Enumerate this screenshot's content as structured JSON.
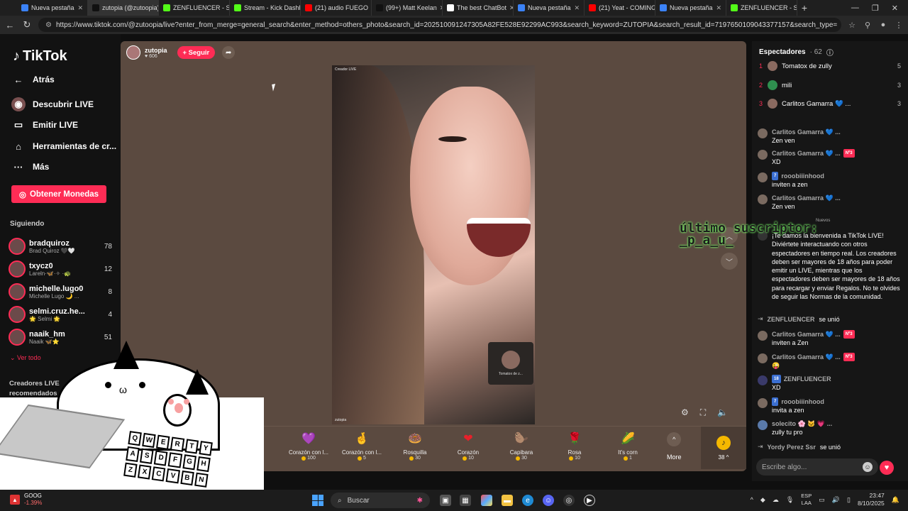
{
  "tabs": [
    {
      "label": "Nueva pestaña",
      "color": "#3b82f6"
    },
    {
      "label": "zutopia (@zutoopia)",
      "color": "#111111"
    },
    {
      "label": "ZENFLUENCER - Stream",
      "color": "#53fc18"
    },
    {
      "label": "Stream - Kick Dashboard",
      "color": "#53fc18"
    },
    {
      "label": "(21) audio FUEGO",
      "color": "#ff0000"
    },
    {
      "label": "(99+) Matt Keelan",
      "color": "#111111"
    },
    {
      "label": "The best ChatBot",
      "color": "#ffffff"
    },
    {
      "label": "Nueva pestaña",
      "color": "#3b82f6"
    },
    {
      "label": "(21) Yeat - COMING",
      "color": "#ff0000"
    },
    {
      "label": "Nueva pestaña",
      "color": "#3b82f6"
    },
    {
      "label": "ZENFLUENCER - Stream",
      "color": "#53fc18"
    }
  ],
  "browser": {
    "url": "https://www.tiktok.com/@zutoopia/live?enter_from_merge=general_search&enter_method=others_photo&search_id=202510091247305A82FE528E92299AC993&search_keyword=ZUTOPIA&search_result_id=7197650109043377157&search_type="
  },
  "sidebar": {
    "logo": "TikTok",
    "back": "Atrás",
    "nav": [
      {
        "label": "Descubrir LIVE",
        "icon": "live-discover-icon"
      },
      {
        "label": "Emitir LIVE",
        "icon": "camera-icon"
      },
      {
        "label": "Herramientas de cr...",
        "icon": "home-tools-icon"
      },
      {
        "label": "Más",
        "icon": "more-dots-icon"
      }
    ],
    "coins_button": "Obtener Monedas",
    "following_title": "Siguiendo",
    "following": [
      {
        "user": "bradquiroz",
        "name": "Brad Quiroz 🖤🤍",
        "count": "78"
      },
      {
        "user": "txycz0",
        "name": "Lareln·🦋·✧ ·🐢",
        "count": "12"
      },
      {
        "user": "michelle.lugo0",
        "name": "Michelle Lugo 🌙 ...",
        "count": "8"
      },
      {
        "user": "selmi.cruz.he...",
        "name": "🌟 Selmi 🌟",
        "count": "4"
      },
      {
        "user": "naaik_hm",
        "name": "Naaik 🦋⭐",
        "count": "51"
      }
    ],
    "see_all": "Ver todo",
    "recommended_title": "Creadores LIVE recomendados"
  },
  "stream": {
    "host_name": "zutopia",
    "host_likes": "606",
    "follow_label": "+ Seguir",
    "video_tag": "Creador LIVE",
    "video_footer": "zutopia",
    "guest_name": "Tomatox de z..."
  },
  "gifts": [
    {
      "name": "...ose",
      "price": "",
      "icon": "🌼",
      "color": "#e8e2b8"
    },
    {
      "name": "Corazón con l...",
      "price": "100",
      "icon": "💜",
      "color": "#d88ad8"
    },
    {
      "name": "Corazón con l...",
      "price": "5",
      "icon": "🤞",
      "color": "#e0a78a"
    },
    {
      "name": "Rosquilla",
      "price": "30",
      "icon": "🍩",
      "color": "#f58aa8"
    },
    {
      "name": "Corazón",
      "price": "10",
      "icon": "❤",
      "color": "#e8202a"
    },
    {
      "name": "Capibara",
      "price": "30",
      "icon": "🦫",
      "color": "#c49060"
    },
    {
      "name": "Rosa",
      "price": "10",
      "icon": "🌹",
      "color": "#d0202a"
    },
    {
      "name": "It's corn",
      "price": "1",
      "icon": "🌽",
      "color": "#f2c230"
    }
  ],
  "gift_more": "More",
  "balance": "38",
  "viewers": {
    "title": "Espectadores",
    "count": "62",
    "top": [
      {
        "rank": "1",
        "name": "Tomatox de zully",
        "value": "5"
      },
      {
        "rank": "2",
        "name": "mili",
        "value": "3"
      },
      {
        "rank": "3",
        "name": "Carlitos Gamarra 💙 ...",
        "value": "3"
      }
    ]
  },
  "chat": {
    "m0_user": "Carlitos Gamarra 💙 ...",
    "m0_text": "Zen ven",
    "m1_user": "Carlitos Gamarra 💙 ...",
    "m1_badge": "Nº3",
    "m1_text": "XD",
    "m2_badge": "7",
    "m2_user": "rooobiiinhood",
    "m2_text": "inviten a zen",
    "m3_user": "Carlitos Gamarra 💙 ...",
    "m3_text": "Zen ven",
    "nuevos": "Nuevos",
    "welcome": "¡Te damos la bienvenida a TikTok LIVE! Diviértete interactuando con otros espectadores en tiempo real. Los creadores deben ser mayores de 18 años para poder emitir un LIVE, mientras que los espectadores deben ser mayores de 18 años para recargar y enviar Regalos. No te olvides de seguir las Normas de la comunidad.",
    "j1_user": "ZENFLUENCER",
    "j1_text": "se unió",
    "m4_user": "Carlitos Gamarra 💙 ...",
    "m4_badge": "Nº3",
    "m4_text": "inviten a Zen",
    "m5_user": "Carlitos Gamarra 💙 ...",
    "m5_badge": "Nº3",
    "m5_text": "😜",
    "m6_badge": "18",
    "m6_user": "ZENFLUENCER",
    "m6_text": "XD",
    "m7_badge": "7",
    "m7_user": "rooobiiinhood",
    "m7_text": "invita a zen",
    "m8_user": "solecito 🌸 🐱 💗 ...",
    "m8_text": "zully tu pro",
    "j2_user": "Yordy Perez Ssr",
    "j2_text": "se unió",
    "input_placeholder": "Escribe algo..."
  },
  "overlay": {
    "line1": "último suscriptor:",
    "line2": "_p_a_u_"
  },
  "bongo_keys": [
    "Q",
    "W",
    "E",
    "R",
    "T",
    "Y",
    "A",
    "S",
    "D",
    "F",
    "G",
    "H",
    "Z",
    "X",
    "C",
    "V",
    "B",
    "N"
  ],
  "taskbar": {
    "stock_name": "GOOG",
    "stock_change": "-1.39%",
    "search": "Buscar",
    "lang1": "ESP",
    "lang2": "LAA",
    "time": "23:47",
    "date": "8/10/2025"
  }
}
